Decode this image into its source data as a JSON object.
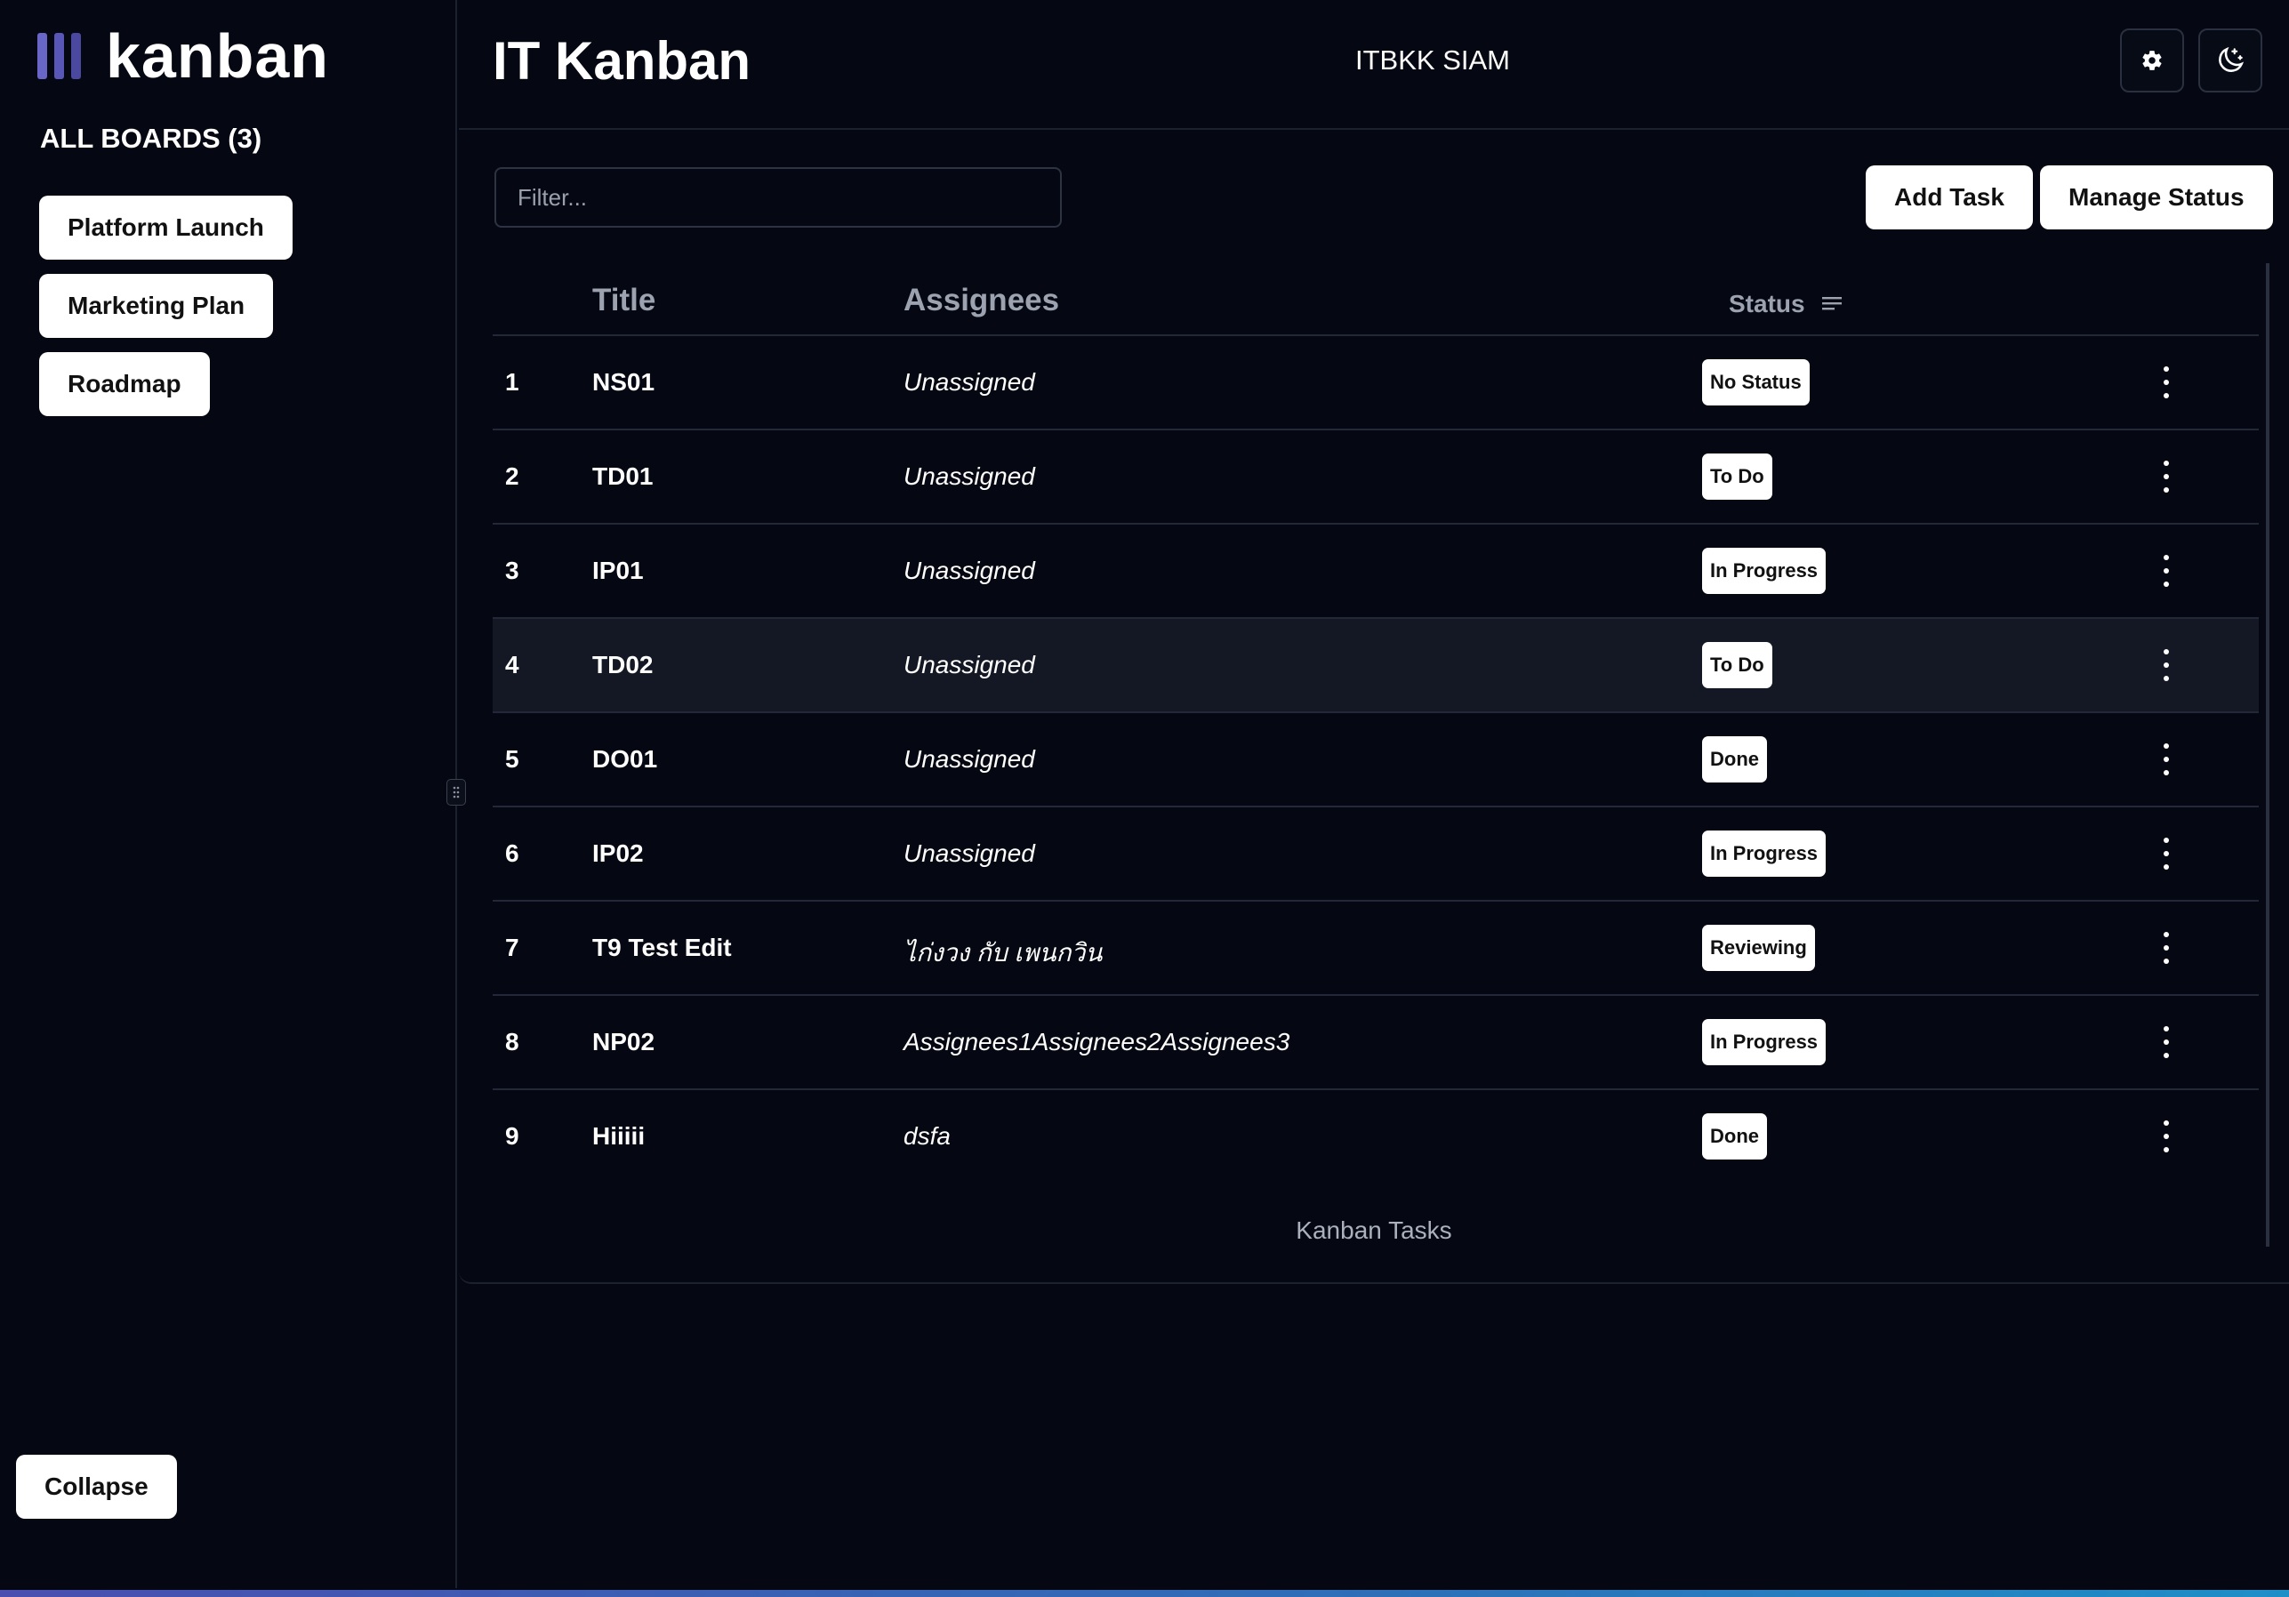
{
  "sidebar": {
    "logo_text": "kanban",
    "boards_heading": "ALL BOARDS (3)",
    "boards": [
      {
        "label": "Platform Launch"
      },
      {
        "label": "Marketing Plan"
      },
      {
        "label": "Roadmap"
      }
    ],
    "collapse_label": "Collapse"
  },
  "header": {
    "title": "IT Kanban",
    "org": "ITBKK SIAM",
    "icons": [
      "gear-icon",
      "moon-icon"
    ]
  },
  "toolbar": {
    "filter_placeholder": "Filter...",
    "add_task_label": "Add Task",
    "manage_status_label": "Manage Status"
  },
  "table": {
    "headers": {
      "title": "Title",
      "assignees": "Assignees",
      "status": "Status"
    },
    "rows": [
      {
        "num": "1",
        "title": "NS01",
        "assignees": "Unassigned",
        "status": "No Status"
      },
      {
        "num": "2",
        "title": "TD01",
        "assignees": "Unassigned",
        "status": "To Do"
      },
      {
        "num": "3",
        "title": "IP01",
        "assignees": "Unassigned",
        "status": "In Progress"
      },
      {
        "num": "4",
        "title": "TD02",
        "assignees": "Unassigned",
        "status": "To Do"
      },
      {
        "num": "5",
        "title": "DO01",
        "assignees": "Unassigned",
        "status": "Done"
      },
      {
        "num": "6",
        "title": "IP02",
        "assignees": "Unassigned",
        "status": "In Progress"
      },
      {
        "num": "7",
        "title": "T9 Test Edit",
        "assignees": "ไก่งวง กับ เพนกวิน",
        "status": "Reviewing"
      },
      {
        "num": "8",
        "title": "NP02",
        "assignees": "Assignees1Assignees2Assignees3",
        "status": "In Progress"
      },
      {
        "num": "9",
        "title": "Hiiiii",
        "assignees": "dsfa",
        "status": "Done"
      }
    ],
    "caption": "Kanban Tasks"
  },
  "colors": {
    "background": "#050812",
    "logo_accent": "#6866c6",
    "button_bg": "#ffffff"
  }
}
